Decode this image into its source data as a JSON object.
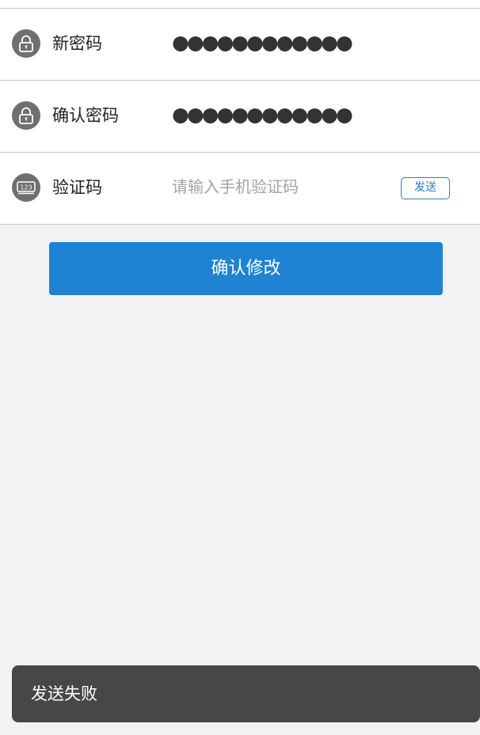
{
  "form": {
    "new_password": {
      "icon": "lock-icon",
      "label": "新密码",
      "value": "●●●●●●●●●●●●"
    },
    "confirm_password": {
      "icon": "lock-icon",
      "label": "确认密码",
      "value": "●●●●●●●●●●●●"
    },
    "verification_code": {
      "icon": "numeric-keypad-icon",
      "label": "验证码",
      "placeholder": "请输入手机验证码",
      "value": "",
      "send_label": "发送"
    }
  },
  "confirm_button": {
    "label": "确认修改"
  },
  "toast": {
    "message": "发送失败"
  },
  "colors": {
    "primary": "#1f82d2",
    "background": "#f2f2f4",
    "toast_bg": "#474747",
    "icon_bg": "#6f6f6f"
  }
}
